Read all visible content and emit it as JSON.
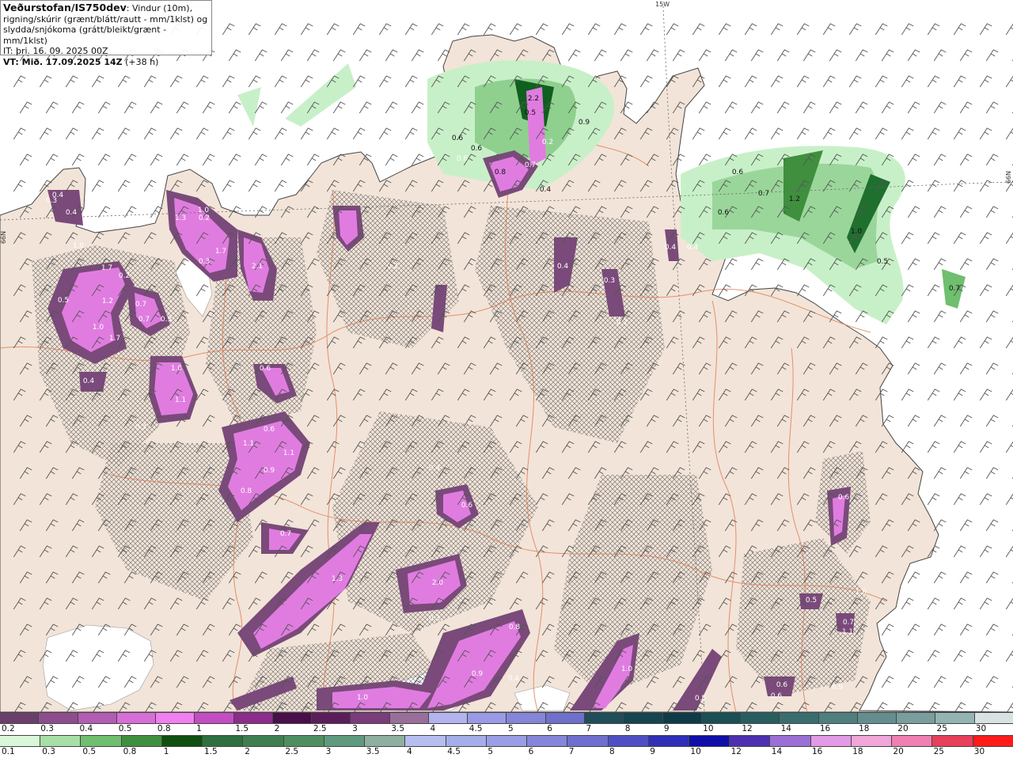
{
  "header": {
    "title": "Veðurstofan/IS750dev",
    "desc_first": ": Vindur (10m),",
    "desc_line2": "rigning/skúrir (grænt/blátt/rautt - mm/1klst) og",
    "desc_line3": "slydda/snjókoma (grátt/bleikt/grænt - mm/1klst)",
    "init_time": "IT: þri. 16. 09. 2025 00Z",
    "valid_label": "VT: Mið. 17.09.2025 14Z",
    "lead": "(+38 h)"
  },
  "coords": {
    "top_lon": "15W",
    "left_lat": "66N",
    "right_lat": "66N"
  },
  "legend_snow": {
    "labels": [
      "0.2",
      "0.3",
      "0.4",
      "0.5",
      "0.8",
      "1",
      "1.5",
      "2",
      "2.5",
      "3",
      "3.5",
      "4",
      "4.5",
      "5",
      "6",
      "7",
      "8",
      "9",
      "10",
      "12",
      "14",
      "16",
      "18",
      "20",
      "25",
      "30"
    ],
    "colors": [
      "#6b3f6b",
      "#8e4e8e",
      "#b35cb3",
      "#d86ed8",
      "#f07ff0",
      "#c34dc3",
      "#8c2c8c",
      "#4a0f4a",
      "#5b1e5b",
      "#7a3c7a",
      "#9a6e9a",
      "#b3b3f0",
      "#9a9ae6",
      "#8585d9",
      "#6f6fcc",
      "#1f4e5a",
      "#164552",
      "#0f3b48",
      "#1a4f55",
      "#285e60",
      "#3a6e6e",
      "#4f7f7f",
      "#648e8e",
      "#7a9e9e",
      "#94b3b3",
      "#d9e2e2"
    ]
  },
  "legend_rain": {
    "labels": [
      "0.1",
      "0.3",
      "0.5",
      "0.8",
      "1",
      "1.5",
      "2",
      "2.5",
      "3",
      "3.5",
      "4",
      "4.5",
      "5",
      "6",
      "7",
      "8",
      "9",
      "10",
      "12",
      "14",
      "16",
      "18",
      "20",
      "25",
      "30"
    ],
    "colors": [
      "#d9f7d9",
      "#a6e0a6",
      "#6fbf6f",
      "#3f8f3f",
      "#0f4f0f",
      "#2f6f3f",
      "#3f7f4f",
      "#4f8f5f",
      "#5f9a7f",
      "#8fb0a0",
      "#b6bef0",
      "#a6aeea",
      "#9a9ee6",
      "#8585dc",
      "#6f6fd0",
      "#4f4fc4",
      "#2f2fb8",
      "#0f0fa8",
      "#4e2fb0",
      "#9b6fd6",
      "#e29be6",
      "#f0a6d9",
      "#f07fb3",
      "#e83f5a",
      "#ff1a1a"
    ]
  },
  "map_labels": [
    "0.4",
    "0.3",
    "0.4",
    "1.3",
    "1.0",
    "0.3",
    "1.7",
    "2.1",
    "0.2",
    "1.0",
    "1.7",
    "0.2",
    "0.5",
    "1.2",
    "0.7",
    "1.0",
    "0.7",
    "0.3",
    "1.7",
    "0.4",
    "1.0",
    "1.1",
    "0.6",
    "0.3",
    "0.6",
    "1.1",
    "1.1",
    "0.9",
    "0.8",
    "0.7",
    "1.3",
    "2.0",
    "0.3",
    "0.4",
    "0.6",
    "0.8",
    "0.9",
    "0.4",
    "1.0",
    "1.0",
    "0.6",
    "0.5",
    "2.2",
    "0.5",
    "0.9",
    "0.6",
    "0.6",
    "0.4",
    "0.8",
    "0.7",
    "0.6",
    "0.2",
    "0.4",
    "0.4",
    "0.3",
    "0.4",
    "0.2",
    "0.6",
    "0.7",
    "1.2",
    "1.0",
    "0.5",
    "0.7",
    "0.6",
    "0.5",
    "1.0",
    "0.7",
    "1.1",
    "0.6",
    "0.9",
    "0.6",
    "0.2"
  ]
}
